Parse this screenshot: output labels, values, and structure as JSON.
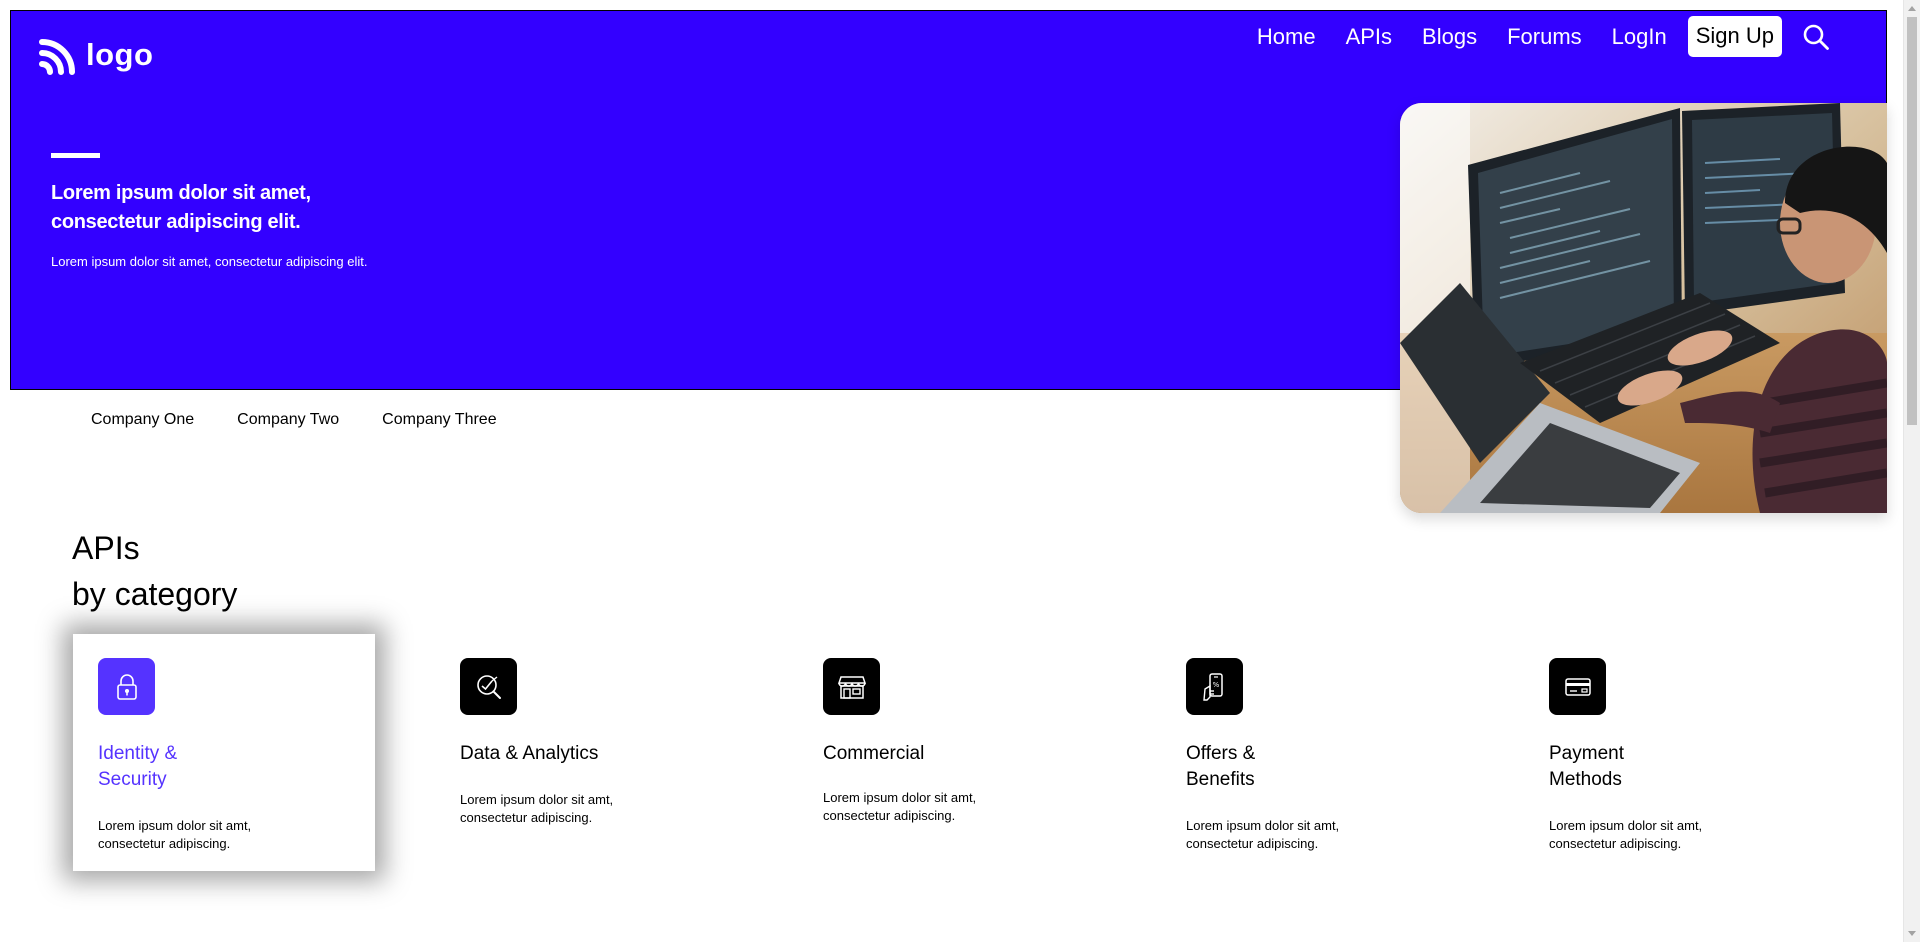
{
  "brand": {
    "logo_text": "logo"
  },
  "nav": {
    "items": [
      "Home",
      "APIs",
      "Blogs",
      "Forums",
      "LogIn"
    ],
    "signup_label": "Sign Up"
  },
  "hero": {
    "title": "Lorem ipsum dolor sit amet, consectetur adipiscing elit.",
    "subtitle": "Lorem ipsum dolor sit amet, consectetur adipiscing elit."
  },
  "companies": [
    "Company One",
    "Company Two",
    "Company Three"
  ],
  "section": {
    "title_line1": "APIs",
    "title_line2": "by category"
  },
  "categories": [
    {
      "title": "Identity & Security",
      "description": "Lorem ipsum dolor sit amt, consectetur adipiscing.",
      "icon": "lock-icon",
      "active": true
    },
    {
      "title": "Data & Analytics",
      "description": "Lorem ipsum dolor sit amt, consectetur adipiscing.",
      "icon": "analytics-icon",
      "active": false
    },
    {
      "title": "Commercial",
      "description": "Lorem ipsum dolor sit amt, consectetur adipiscing.",
      "icon": "store-icon",
      "active": false
    },
    {
      "title": "Offers & Benefits",
      "description": "Lorem ipsum dolor sit amt, consectetur adipiscing.",
      "icon": "offers-icon",
      "active": false
    },
    {
      "title": "Payment Methods",
      "description": "Lorem ipsum dolor sit amt, consectetur adipiscing.",
      "icon": "card-icon",
      "active": false
    }
  ],
  "colors": {
    "hero_background": "#3300ff",
    "accent": "#5533ff",
    "icon_background": "#000000"
  }
}
